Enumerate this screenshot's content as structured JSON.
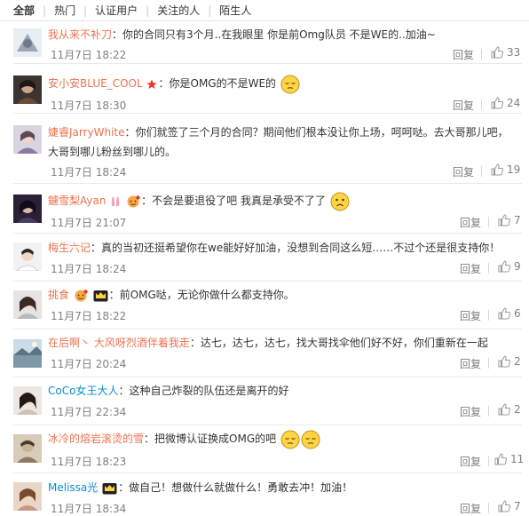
{
  "filters": [
    "全部",
    "热门",
    "认证用户",
    "关注的人",
    "陌生人"
  ],
  "reply_label": "回复",
  "comments": [
    {
      "user": "我从来不补刀",
      "sep": "：",
      "text": "你的合同只有3个月..在我眼里 你是前Omg队员 不是WE的..加油~",
      "time": "11月7日 18:22",
      "likes": "33"
    },
    {
      "user": "安小安BLUE_COOL",
      "sep": "：",
      "text": "你是OMG的不是WE的",
      "time": "11月7日 18:30",
      "likes": "24"
    },
    {
      "user": "婕睿JarryWhite",
      "sep": "：",
      "text": "你们就签了三个月的合同？期间他们根本没让你上场，呵呵哒。去大哥那儿吧，大哥到哪儿粉丝到哪儿的。",
      "time": "11月7日 18:24",
      "likes": "19"
    },
    {
      "user": "鑢雪梨Ayan",
      "sep": "：",
      "text": "不会是要退役了吧 我真是承受不了了",
      "time": "11月7日 21:07",
      "likes": "7"
    },
    {
      "user": "梅生六记",
      "sep": "：",
      "text": "真的当初还挺希望你在we能好好加油，没想到合同这么短……不过个还是很支持你！",
      "time": "11月7日 18:24",
      "likes": "9"
    },
    {
      "user": "挑食",
      "sep": "：",
      "text": "前OMG哒，无论你做什么都支持你。",
      "time": "11月7日 18:22",
      "likes": "6"
    },
    {
      "user": "在后啊丶 大风呀烈酒伴着我走",
      "sep": "：",
      "text": "达七，达七，达七，找大哥找伞他们好不好，你们重新在一起",
      "time": "11月7日 20:24",
      "likes": "2"
    },
    {
      "user": "CoCo女王大人",
      "sep": "：",
      "text": "这种自己炸裂的队伍还是离开的好",
      "time": "11月7日 22:34",
      "likes": "2"
    },
    {
      "user": "冰冷的熔岩滚烫的雪",
      "sep": "：",
      "text": "把微博认证换成OMG的吧",
      "time": "11月7日 18:23",
      "likes": "11"
    },
    {
      "user": "Melissa光",
      "sep": "：",
      "text": "做自己！想做什么就做什么！勇敢去冲！加油！",
      "time": "11月7日 18:34",
      "likes": "7"
    }
  ],
  "colors": {
    "username": "#eb7350",
    "username_alt": "#0a8cd2",
    "meta": "#808080",
    "divider": "#eaeaea"
  }
}
